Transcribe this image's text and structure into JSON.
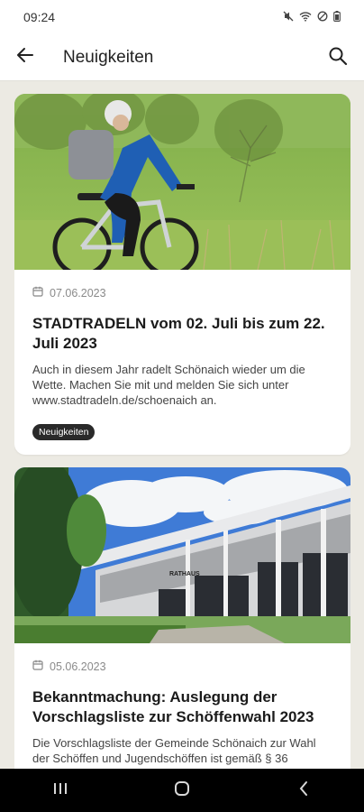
{
  "status_bar": {
    "time": "09:24"
  },
  "app_bar": {
    "title": "Neuigkeiten"
  },
  "feed": {
    "items": [
      {
        "date": "07.06.2023",
        "title": "STADTRADELN vom 02. Juli bis zum 22. Juli 2023",
        "text": "Auch in diesem Jahr radelt Schönaich wieder um die Wette. Machen Sie mit und melden Sie sich unter www.stadtradeln.de/schoenaich an.",
        "tag": "Neuigkeiten"
      },
      {
        "date": "05.06.2023",
        "title": "Bekanntmachung: Auslegung der Vorschlagsliste zur Schöffenwahl 2023",
        "text": "Die Vorschlagsliste der Gemeinde Schönaich zur Wahl der Schöffen und Jugendschöffen ist gemäß § 36"
      }
    ]
  },
  "building_sign": "RATHAUS",
  "colors": {
    "background": "#eceae3",
    "tag_bg": "#2a2a2a",
    "nav_bar": "#000000"
  }
}
